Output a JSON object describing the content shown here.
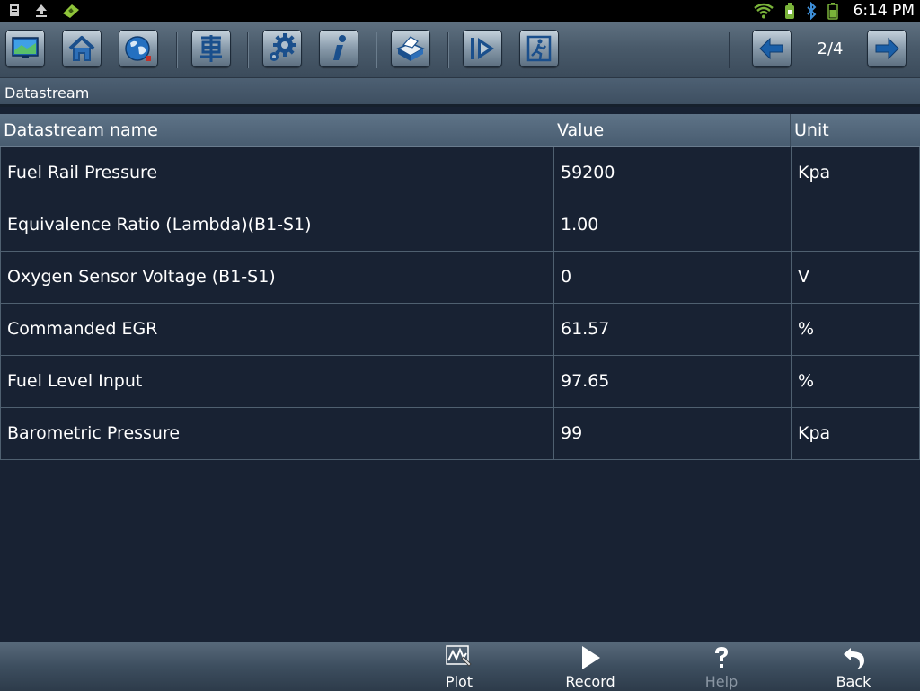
{
  "status_bar": {
    "time": "6:14 PM",
    "left_icons": [
      "sd-card-icon",
      "upload-icon",
      "usb-debug-icon"
    ],
    "right_icons": [
      "wifi-icon",
      "battery-saver-icon",
      "bluetooth-icon",
      "battery-icon"
    ]
  },
  "toolbar": {
    "buttons": [
      "display-icon",
      "home-icon",
      "globe-icon",
      "car-icon",
      "settings-icon",
      "info-icon",
      "print-icon",
      "play-icon",
      "exit-icon"
    ],
    "page_indicator": "2/4"
  },
  "section": {
    "title": "Datastream"
  },
  "table": {
    "headers": {
      "name": "Datastream name",
      "value": "Value",
      "unit": "Unit"
    },
    "rows": [
      {
        "name": "Fuel Rail Pressure",
        "value": "59200",
        "unit": "Kpa"
      },
      {
        "name": "Equivalence Ratio (Lambda)(B1-S1)",
        "value": "1.00",
        "unit": ""
      },
      {
        "name": "Oxygen Sensor Voltage (B1-S1)",
        "value": "0",
        "unit": "V"
      },
      {
        "name": "Commanded EGR",
        "value": "61.57",
        "unit": "%"
      },
      {
        "name": "Fuel Level Input",
        "value": "97.65",
        "unit": "%"
      },
      {
        "name": "Barometric Pressure",
        "value": "99",
        "unit": "Kpa"
      }
    ]
  },
  "bottom_bar": {
    "plot": "Plot",
    "record": "Record",
    "help": "Help",
    "back": "Back"
  },
  "colors": {
    "background": "#182233",
    "toolbar": "#4a5b6b",
    "accent_blue": "#2a5c9a",
    "disabled_text": "#8a96a3"
  }
}
